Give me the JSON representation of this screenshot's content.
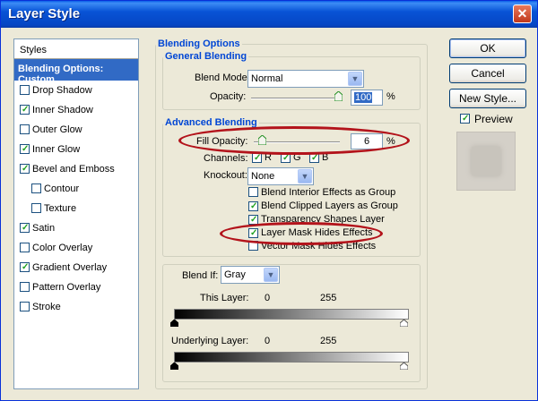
{
  "window": {
    "title": "Layer Style",
    "close_glyph": "✕"
  },
  "styles_panel": {
    "header": "Styles",
    "selected": "Blending Options: Custom",
    "items": [
      {
        "label": "Drop Shadow",
        "checked": false,
        "sub": false
      },
      {
        "label": "Inner Shadow",
        "checked": true,
        "sub": false
      },
      {
        "label": "Outer Glow",
        "checked": false,
        "sub": false
      },
      {
        "label": "Inner Glow",
        "checked": true,
        "sub": false
      },
      {
        "label": "Bevel and Emboss",
        "checked": true,
        "sub": false
      },
      {
        "label": "Contour",
        "checked": false,
        "sub": true
      },
      {
        "label": "Texture",
        "checked": false,
        "sub": true
      },
      {
        "label": "Satin",
        "checked": true,
        "sub": false
      },
      {
        "label": "Color Overlay",
        "checked": false,
        "sub": false
      },
      {
        "label": "Gradient Overlay",
        "checked": true,
        "sub": false
      },
      {
        "label": "Pattern Overlay",
        "checked": false,
        "sub": false
      },
      {
        "label": "Stroke",
        "checked": false,
        "sub": false
      }
    ]
  },
  "blending": {
    "section_title": "Blending Options",
    "general_title": "General Blending",
    "blend_mode_label": "Blend Mode:",
    "blend_mode_value": "Normal",
    "opacity_label": "Opacity:",
    "opacity_value": "100",
    "opacity_level": 100,
    "percent": "%"
  },
  "advanced": {
    "title": "Advanced Blending",
    "fill_opacity_label": "Fill Opacity:",
    "fill_opacity_value": "6",
    "fill_opacity_level": 6,
    "channels_label": "Channels:",
    "channels": [
      {
        "label": "R",
        "checked": true
      },
      {
        "label": "G",
        "checked": true
      },
      {
        "label": "B",
        "checked": true
      }
    ],
    "knockout_label": "Knockout:",
    "knockout_value": "None",
    "options": [
      {
        "label": "Blend Interior Effects as Group",
        "checked": false
      },
      {
        "label": "Blend Clipped Layers as Group",
        "checked": true
      },
      {
        "label": "Transparency Shapes Layer",
        "checked": true
      },
      {
        "label": "Layer Mask Hides Effects",
        "checked": true
      },
      {
        "label": "Vector Mask Hides Effects",
        "checked": false
      }
    ]
  },
  "blend_if": {
    "label": "Blend If:",
    "value": "Gray",
    "this_layer_label": "This Layer:",
    "this_layer_min": "0",
    "this_layer_max": "255",
    "underlying_label": "Underlying Layer:",
    "underlying_min": "0",
    "underlying_max": "255"
  },
  "buttons": {
    "ok": "OK",
    "cancel": "Cancel",
    "new_style": "New Style...",
    "preview_label": "Preview",
    "preview_checked": true
  },
  "dropdown_glyph": "▼",
  "annotation_color": "#b3131b"
}
